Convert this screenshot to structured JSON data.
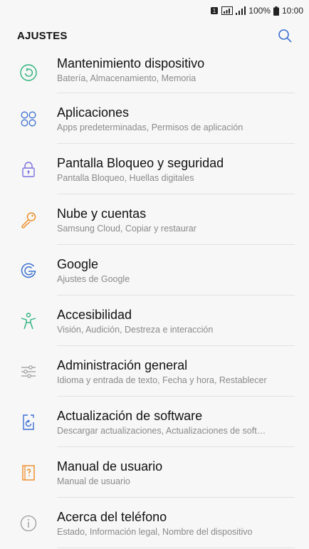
{
  "status_bar": {
    "battery": "100%",
    "time": "10:00"
  },
  "header": {
    "title": "AJUSTES"
  },
  "colors": {
    "teal": "#2ab27b",
    "blue": "#3b6fd4",
    "purple": "#7a6fe0",
    "orange": "#f08a24",
    "gray": "#9a9a9a"
  },
  "items": [
    {
      "title": "Mantenimiento dispositivo",
      "subtitle": "Batería, Almacenamiento, Memoria",
      "icon": "device-maintenance-icon"
    },
    {
      "title": "Aplicaciones",
      "subtitle": "Apps predeterminadas, Permisos de aplicación",
      "icon": "apps-icon"
    },
    {
      "title": "Pantalla Bloqueo y seguridad",
      "subtitle": "Pantalla Bloqueo, Huellas digitales",
      "icon": "lock-icon"
    },
    {
      "title": "Nube y cuentas",
      "subtitle": "Samsung Cloud, Copiar y restaurar",
      "icon": "key-icon"
    },
    {
      "title": "Google",
      "subtitle": "Ajustes de Google",
      "icon": "google-icon"
    },
    {
      "title": "Accesibilidad",
      "subtitle": "Visión, Audición, Destreza e interacción",
      "icon": "accessibility-icon"
    },
    {
      "title": "Administración general",
      "subtitle": "Idioma y entrada de texto, Fecha y hora, Restablecer",
      "icon": "sliders-icon"
    },
    {
      "title": "Actualización de software",
      "subtitle": "Descargar actualizaciones, Actualizaciones de soft…",
      "icon": "software-update-icon"
    },
    {
      "title": "Manual de usuario",
      "subtitle": "Manual de usuario",
      "icon": "user-manual-icon"
    },
    {
      "title": "Acerca del teléfono",
      "subtitle": "Estado, Información legal, Nombre del dispositivo",
      "icon": "info-icon"
    }
  ]
}
